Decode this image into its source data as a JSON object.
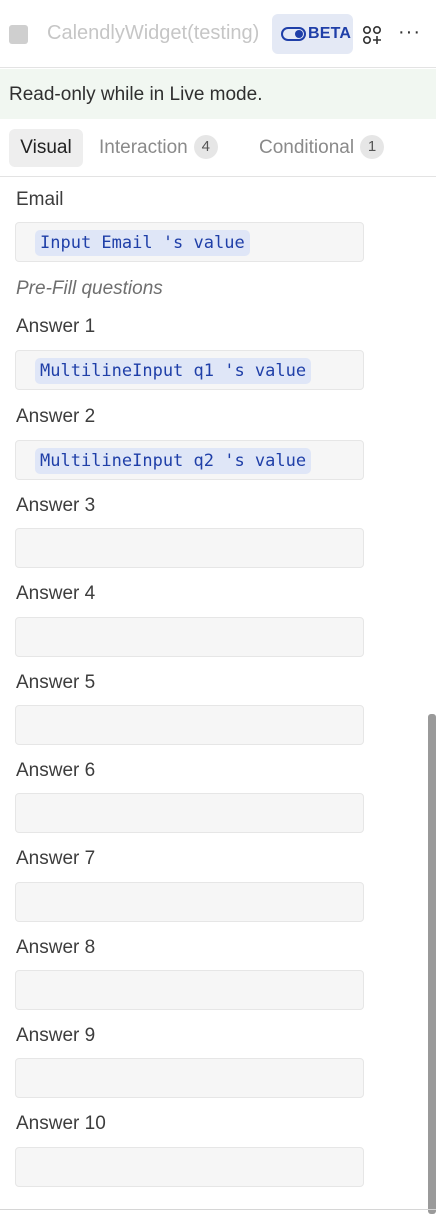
{
  "header": {
    "title": "CalendlyWidget(testing)",
    "beta_label": "BETA",
    "icons": {
      "widget": "add-widgets-icon",
      "more": "more-horizontal-icon"
    },
    "more_glyph": "···"
  },
  "banner": {
    "text": "Read-only while in Live mode."
  },
  "tabs": {
    "visual": {
      "label": "Visual"
    },
    "interaction": {
      "label": "Interaction",
      "count": "4"
    },
    "conditional": {
      "label": "Conditional",
      "count": "1"
    }
  },
  "form": {
    "email": {
      "label": "Email",
      "value": "Input Email 's value"
    },
    "section_title": "Pre-Fill questions",
    "answers": [
      {
        "label": "Answer 1",
        "value": "MultilineInput q1 's value"
      },
      {
        "label": "Answer 2",
        "value": "MultilineInput q2 's value"
      },
      {
        "label": "Answer 3",
        "value": ""
      },
      {
        "label": "Answer 4",
        "value": ""
      },
      {
        "label": "Answer 5",
        "value": ""
      },
      {
        "label": "Answer 6",
        "value": ""
      },
      {
        "label": "Answer 7",
        "value": ""
      },
      {
        "label": "Answer 8",
        "value": ""
      },
      {
        "label": "Answer 9",
        "value": ""
      },
      {
        "label": "Answer 10",
        "value": ""
      }
    ]
  },
  "colors": {
    "accent": "#1f3fa8",
    "chip_background": "#dfe6f7",
    "banner_background": "#f1f7f1"
  }
}
